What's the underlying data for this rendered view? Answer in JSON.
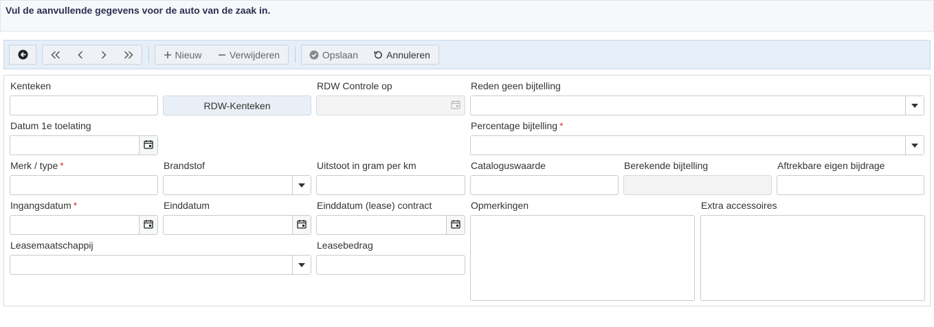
{
  "header": {
    "instruction": "Vul de aanvullende gegevens voor de auto van de zaak in."
  },
  "toolbar": {
    "new_label": "Nieuw",
    "delete_label": "Verwijderen",
    "save_label": "Opslaan",
    "cancel_label": "Annuleren"
  },
  "form": {
    "kenteken": {
      "label": "Kenteken",
      "value": ""
    },
    "rdw_button": "RDW-Kenteken",
    "rdw_controle": {
      "label": "RDW Controle op",
      "value": ""
    },
    "reden_geen_bijtelling": {
      "label": "Reden geen bijtelling",
      "value": ""
    },
    "datum_1e_toelating": {
      "label": "Datum 1e toelating",
      "value": ""
    },
    "percentage_bijtelling": {
      "label": "Percentage bijtelling",
      "required": "*",
      "value": ""
    },
    "merk_type": {
      "label": "Merk / type",
      "required": "*",
      "value": ""
    },
    "brandstof": {
      "label": "Brandstof",
      "value": ""
    },
    "uitstoot": {
      "label": "Uitstoot in gram per km",
      "value": ""
    },
    "cataloguswaarde": {
      "label": "Cataloguswaarde",
      "value": ""
    },
    "berekende_bijtelling": {
      "label": "Berekende bijtelling",
      "value": ""
    },
    "aftrekbare_eigen_bijdrage": {
      "label": "Aftrekbare eigen bijdrage",
      "value": ""
    },
    "ingangsdatum": {
      "label": "Ingangsdatum",
      "required": "*",
      "value": ""
    },
    "einddatum": {
      "label": "Einddatum",
      "value": ""
    },
    "einddatum_contract": {
      "label": "Einddatum (lease) contract",
      "value": ""
    },
    "opmerkingen": {
      "label": "Opmerkingen",
      "value": ""
    },
    "extra_accessoires": {
      "label": "Extra accessoires",
      "value": ""
    },
    "leasemaatschappij": {
      "label": "Leasemaatschappij",
      "value": ""
    },
    "leasebedrag": {
      "label": "Leasebedrag",
      "value": ""
    }
  },
  "colors": {
    "required": "#d9363e",
    "toolbar_bg": "#e6eef8",
    "header_text": "#2a2f52"
  }
}
